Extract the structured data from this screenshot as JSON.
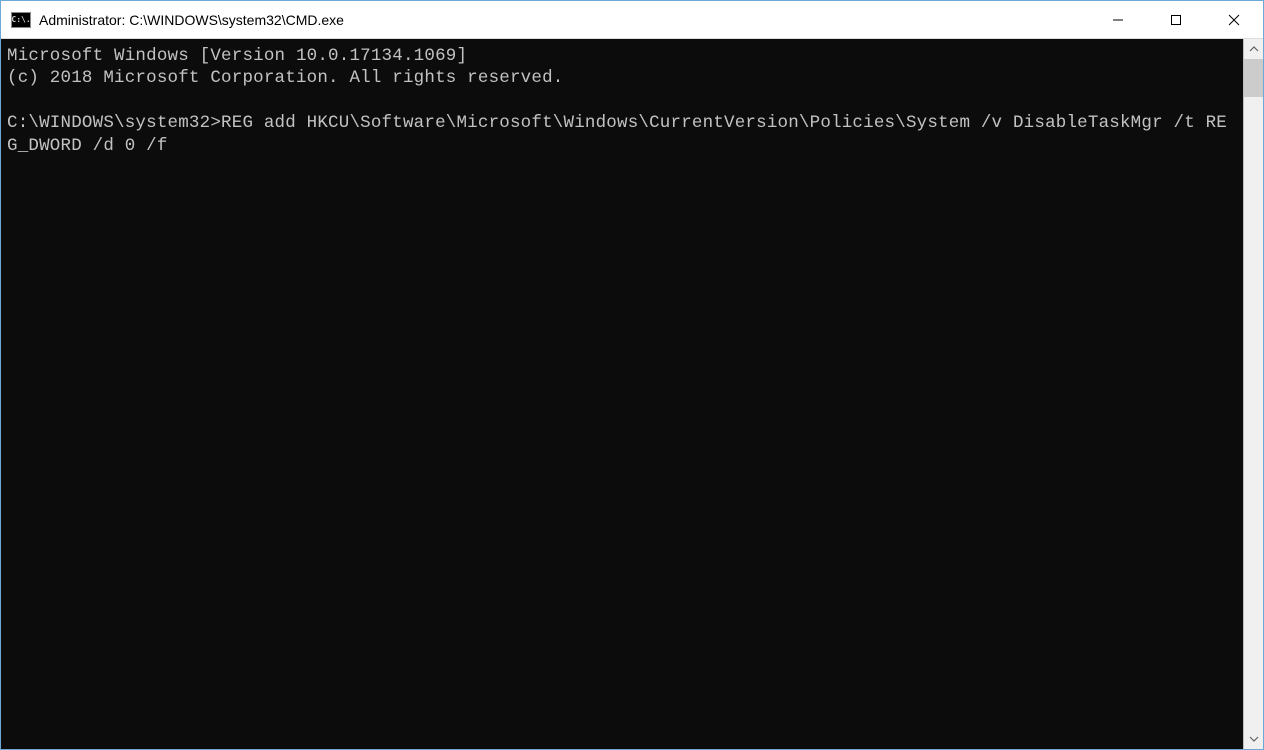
{
  "titlebar": {
    "icon_label": "C:\\.",
    "title": "Administrator: C:\\WINDOWS\\system32\\CMD.exe"
  },
  "console": {
    "content": "Microsoft Windows [Version 10.0.17134.1069]\n(c) 2018 Microsoft Corporation. All rights reserved.\n\nC:\\WINDOWS\\system32>REG add HKCU\\Software\\Microsoft\\Windows\\CurrentVersion\\Policies\\System /v DisableTaskMgr /t REG_DWORD /d 0 /f"
  }
}
